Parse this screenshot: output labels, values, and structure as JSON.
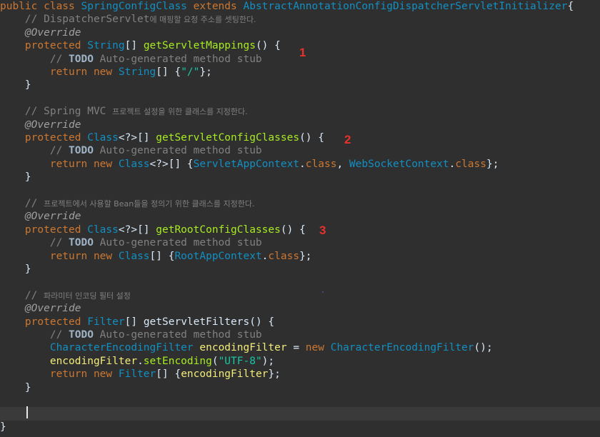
{
  "colors": {
    "background": "#2f2f2f",
    "current_line": "#3a3a3a",
    "keyword": "#cc7832",
    "type": "#1290c3",
    "method": "#a7ec21",
    "comment": "#808080",
    "string": "#17c6a3",
    "variable": "#f3ec79",
    "plain": "#d9e8f7",
    "marker": "#e5322d"
  },
  "markers": [
    "1",
    "2",
    "3"
  ],
  "code": [
    {
      "tokens": [
        {
          "c": "kw",
          "t": "public class "
        },
        {
          "c": "type",
          "t": "SpringConfigClass"
        },
        {
          "c": "kw",
          "t": " extends "
        },
        {
          "c": "type",
          "t": "AbstractAnnotationConfigDispatcherServletInitializer"
        },
        {
          "c": "plain",
          "t": "{"
        }
      ]
    },
    {
      "tokens": [
        {
          "c": "comment",
          "t": "    // DispatcherServlet"
        },
        {
          "c": "comment-ko",
          "t": "에 매핑할 요청 주소를 셋팅한다."
        }
      ]
    },
    {
      "tokens": [
        {
          "c": "ann",
          "t": "    @Override"
        }
      ]
    },
    {
      "tokens": [
        {
          "c": "kw",
          "t": "    protected "
        },
        {
          "c": "type",
          "t": "String"
        },
        {
          "c": "plain",
          "t": "[] "
        },
        {
          "c": "method",
          "t": "getServletMappings"
        },
        {
          "c": "plain",
          "t": "() {"
        }
      ]
    },
    {
      "tokens": [
        {
          "c": "comment",
          "t": "        // "
        },
        {
          "c": "todo",
          "t": "TODO"
        },
        {
          "c": "comment",
          "t": " Auto-generated method stub"
        }
      ]
    },
    {
      "tokens": [
        {
          "c": "kw",
          "t": "        return new "
        },
        {
          "c": "type",
          "t": "String"
        },
        {
          "c": "plain",
          "t": "[] {"
        },
        {
          "c": "str",
          "t": "\"/\""
        },
        {
          "c": "plain",
          "t": "};"
        }
      ]
    },
    {
      "tokens": [
        {
          "c": "plain",
          "t": "    }"
        }
      ]
    },
    {
      "tokens": []
    },
    {
      "tokens": [
        {
          "c": "comment",
          "t": "    // Spring MVC "
        },
        {
          "c": "comment-ko",
          "t": "프로젝트 설정을 위한 클래스를 지정한다."
        }
      ]
    },
    {
      "tokens": [
        {
          "c": "ann",
          "t": "    @Override"
        }
      ]
    },
    {
      "tokens": [
        {
          "c": "kw",
          "t": "    protected "
        },
        {
          "c": "type",
          "t": "Class"
        },
        {
          "c": "plain",
          "t": "<?>[] "
        },
        {
          "c": "method",
          "t": "getServletConfigClasses"
        },
        {
          "c": "plain",
          "t": "() {"
        }
      ]
    },
    {
      "tokens": [
        {
          "c": "comment",
          "t": "        // "
        },
        {
          "c": "todo",
          "t": "TODO"
        },
        {
          "c": "comment",
          "t": " Auto-generated method stub"
        }
      ]
    },
    {
      "tokens": [
        {
          "c": "kw",
          "t": "        return new "
        },
        {
          "c": "type",
          "t": "Class"
        },
        {
          "c": "plain",
          "t": "<?>[] {"
        },
        {
          "c": "type",
          "t": "ServletAppContext"
        },
        {
          "c": "plain",
          "t": "."
        },
        {
          "c": "kw",
          "t": "class"
        },
        {
          "c": "plain",
          "t": ", "
        },
        {
          "c": "type",
          "t": "WebSocketContext"
        },
        {
          "c": "plain",
          "t": "."
        },
        {
          "c": "kw",
          "t": "class"
        },
        {
          "c": "plain",
          "t": "};"
        }
      ]
    },
    {
      "tokens": [
        {
          "c": "plain",
          "t": "    }"
        }
      ]
    },
    {
      "tokens": []
    },
    {
      "tokens": [
        {
          "c": "comment",
          "t": "    // "
        },
        {
          "c": "comment-ko",
          "t": "프로젝트에서 사용할 Bean들을 정의기 위한 클래스를 지정한다."
        }
      ]
    },
    {
      "tokens": [
        {
          "c": "ann",
          "t": "    @Override"
        }
      ]
    },
    {
      "tokens": [
        {
          "c": "kw",
          "t": "    protected "
        },
        {
          "c": "type",
          "t": "Class"
        },
        {
          "c": "plain",
          "t": "<?>[] "
        },
        {
          "c": "method",
          "t": "getRootConfigClasses"
        },
        {
          "c": "plain",
          "t": "() {"
        }
      ]
    },
    {
      "tokens": [
        {
          "c": "comment",
          "t": "        // "
        },
        {
          "c": "todo",
          "t": "TODO"
        },
        {
          "c": "comment",
          "t": " Auto-generated method stub"
        }
      ]
    },
    {
      "tokens": [
        {
          "c": "kw",
          "t": "        return new "
        },
        {
          "c": "type",
          "t": "Class"
        },
        {
          "c": "plain",
          "t": "[] {"
        },
        {
          "c": "type",
          "t": "RootAppContext"
        },
        {
          "c": "plain",
          "t": "."
        },
        {
          "c": "kw",
          "t": "class"
        },
        {
          "c": "plain",
          "t": "};"
        }
      ]
    },
    {
      "tokens": [
        {
          "c": "plain",
          "t": "    }"
        }
      ]
    },
    {
      "tokens": []
    },
    {
      "tokens": [
        {
          "c": "comment",
          "t": "    // "
        },
        {
          "c": "comment-ko",
          "t": "파라미터 인코딩 필터 설정"
        }
      ]
    },
    {
      "tokens": [
        {
          "c": "ann",
          "t": "    @Override"
        }
      ]
    },
    {
      "tokens": [
        {
          "c": "kw",
          "t": "    protected "
        },
        {
          "c": "type",
          "t": "Filter"
        },
        {
          "c": "plain",
          "t": "[] "
        },
        {
          "c": "plain",
          "t": "getServletFilters"
        },
        {
          "c": "plain",
          "t": "() {"
        }
      ]
    },
    {
      "tokens": [
        {
          "c": "comment",
          "t": "        // "
        },
        {
          "c": "todo",
          "t": "TODO"
        },
        {
          "c": "comment",
          "t": " Auto-generated method stub"
        }
      ]
    },
    {
      "tokens": [
        {
          "c": "plain",
          "t": "        "
        },
        {
          "c": "type",
          "t": "CharacterEncodingFilter"
        },
        {
          "c": "plain",
          "t": " "
        },
        {
          "c": "var",
          "t": "encodingFilter"
        },
        {
          "c": "plain",
          "t": " = "
        },
        {
          "c": "kw",
          "t": "new "
        },
        {
          "c": "type",
          "t": "CharacterEncodingFilter"
        },
        {
          "c": "plain",
          "t": "();"
        }
      ]
    },
    {
      "tokens": [
        {
          "c": "plain",
          "t": "        "
        },
        {
          "c": "var",
          "t": "encodingFilter"
        },
        {
          "c": "plain",
          "t": "."
        },
        {
          "c": "method",
          "t": "setEncoding"
        },
        {
          "c": "plain",
          "t": "("
        },
        {
          "c": "str",
          "t": "\"UTF-8\""
        },
        {
          "c": "plain",
          "t": ");"
        }
      ]
    },
    {
      "tokens": [
        {
          "c": "kw",
          "t": "        return new "
        },
        {
          "c": "type",
          "t": "Filter"
        },
        {
          "c": "plain",
          "t": "[] {"
        },
        {
          "c": "var",
          "t": "encodingFilter"
        },
        {
          "c": "plain",
          "t": "};"
        }
      ]
    },
    {
      "tokens": [
        {
          "c": "plain",
          "t": "    }"
        }
      ]
    },
    {
      "tokens": []
    },
    {
      "tokens": [],
      "current": true
    },
    {
      "tokens": [
        {
          "c": "plain",
          "t": "}"
        }
      ]
    }
  ]
}
